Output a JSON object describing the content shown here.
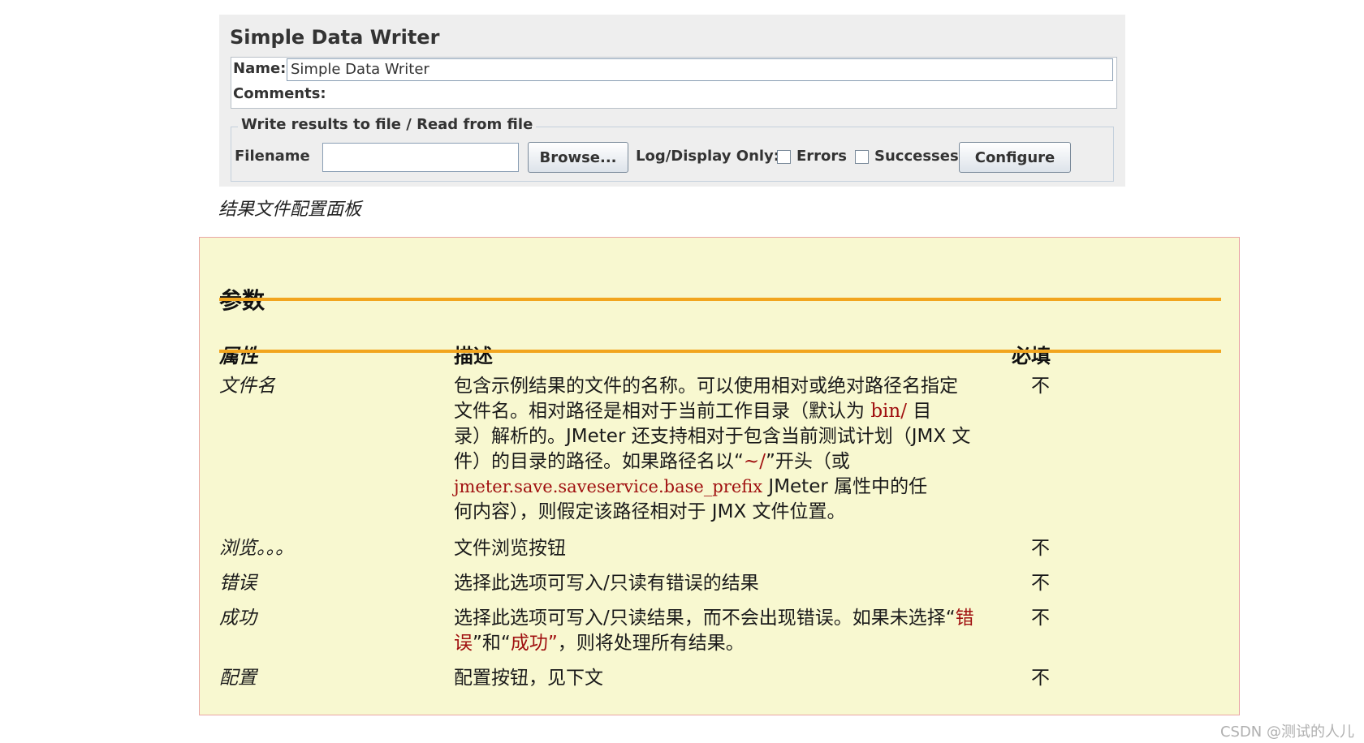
{
  "panel": {
    "title": "Simple Data Writer",
    "name_label": "Name:",
    "name_value": "Simple Data Writer",
    "comments_label": "Comments:",
    "group_title": "Write results to file / Read from file",
    "filename_label": "Filename",
    "filename_value": "",
    "browse_label": "Browse...",
    "log_display_label": "Log/Display Only:",
    "errors_label": "Errors",
    "errors_checked": false,
    "successes_label": "Successes",
    "successes_checked": false,
    "configure_label": "Configure"
  },
  "caption": "结果文件配置面板",
  "params": {
    "title": "参数",
    "headers": {
      "property": "属性",
      "description": "描述",
      "required": "必填"
    },
    "rows": [
      {
        "property": "文件名",
        "desc": {
          "l1": "包含示例结果的文件的名称。可以使用相对或绝对路径名指定",
          "l2a": "文件名。相对路径是相对于当前工作目录（默认为 ",
          "l2code": "bin/",
          "l2b": " 目",
          "l3": "录）解析的。JMeter 还支持相对于包含当前测试计划（JMX 文",
          "l4a": "件）的目录的路径。如果路径名以“",
          "l4code": "~/",
          "l4b": "”开头（或",
          "l5code": "jmeter.save.saveservice.base_prefix",
          "l5b": " JMeter 属性中的任",
          "l6": "何内容），则假定该路径相对于 JMX 文件位置。"
        },
        "required": "不"
      },
      {
        "property": "浏览。。。",
        "desc_text": "文件浏览按钮",
        "required": "不"
      },
      {
        "property": "错误",
        "desc_text": "选择此选项可写入/只读有错误的结果",
        "required": "不"
      },
      {
        "property": "成功",
        "desc": {
          "l1a": "选择此选项可写入/只读结果，而不会出现错误。如果未选择“",
          "l1red": "错",
          "l2red": "误",
          "l2b": "”和“",
          "l2red2": "成功”",
          "l2c": "，则将处理所有结果。"
        },
        "required": "不"
      },
      {
        "property": "配置",
        "desc_text": "配置按钮，见下文",
        "required": "不"
      }
    ]
  },
  "watermark": "CSDN @测试的人儿"
}
